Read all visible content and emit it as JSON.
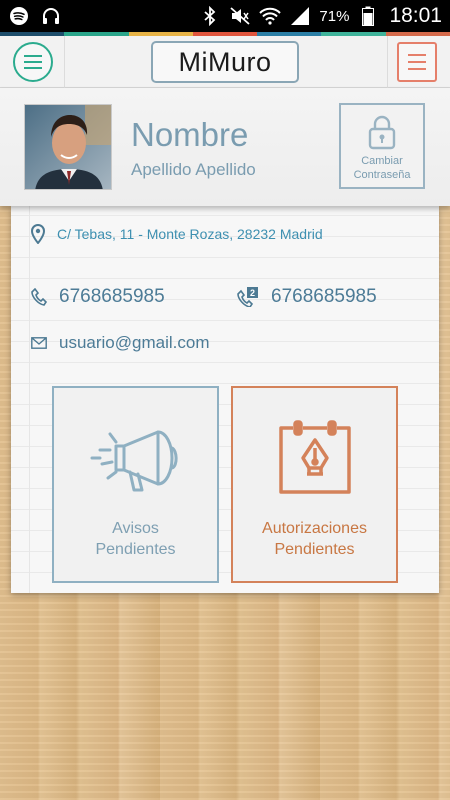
{
  "status_bar": {
    "battery_percent": "71%",
    "time": "18:01",
    "icons": [
      "spotify-icon",
      "headphones-icon",
      "bluetooth-icon",
      "mute-icon",
      "wifi-icon",
      "signal-icon",
      "battery-icon"
    ]
  },
  "color_strip": [
    "#1d4d6b",
    "#2aa58a",
    "#e7b346",
    "#e0553d",
    "#2b7fa6",
    "#3fb39a",
    "#d46a4b"
  ],
  "header": {
    "title": "MiMuro",
    "left_button_icon": "menu-icon",
    "right_button_icon": "menu-icon"
  },
  "profile": {
    "name": "Nombre",
    "surname": "Apellido Apellido",
    "change_password_label_1": "Cambiar",
    "change_password_label_2": "Contraseña"
  },
  "contact": {
    "address": "C/ Tebas, 11 - Monte Rozas, 28232 Madrid",
    "phone": "6768685985",
    "phone_2": "6768685985",
    "phone_2_badge": "2",
    "email": "usuario@gmail.com"
  },
  "tiles": {
    "avisos_line1": "Avisos",
    "avisos_line2": "Pendientes",
    "autoriz_line1": "Autorizaciones",
    "autoriz_line2": "Pendientes"
  },
  "colors": {
    "accent_green": "#2bab8e",
    "accent_red": "#e57f6a",
    "blue_gray": "#7a9cb0",
    "orange": "#d4825a"
  }
}
